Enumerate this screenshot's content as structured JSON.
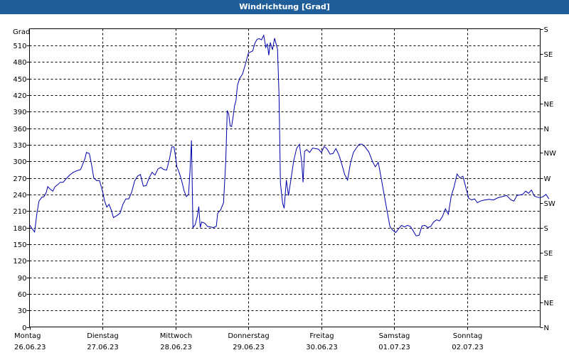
{
  "window": {
    "title": "Windrichtung [Grad]"
  },
  "chart_data": {
    "type": "line",
    "title": "Windrichtung [Grad]",
    "ylabel": "Grad",
    "ylim": [
      0,
      540
    ],
    "yticks": [
      0,
      30,
      60,
      90,
      120,
      150,
      180,
      210,
      240,
      270,
      300,
      330,
      360,
      390,
      420,
      450,
      480,
      510
    ],
    "right_axis_labels": [
      {
        "value": 0,
        "label": "N"
      },
      {
        "value": 45,
        "label": "NE"
      },
      {
        "value": 90,
        "label": "E"
      },
      {
        "value": 135,
        "label": "SE"
      },
      {
        "value": 180,
        "label": "S"
      },
      {
        "value": 225,
        "label": "SW"
      },
      {
        "value": 270,
        "label": "W"
      },
      {
        "value": 315,
        "label": "NW"
      },
      {
        "value": 360,
        "label": "N"
      },
      {
        "value": 405,
        "label": "NE"
      },
      {
        "value": 450,
        "label": "E"
      },
      {
        "value": 495,
        "label": "SE"
      },
      {
        "value": 540,
        "label": "S"
      }
    ],
    "x_range": [
      0,
      7
    ],
    "days": [
      {
        "day": "Montag",
        "date": "26.06.23"
      },
      {
        "day": "Dienstag",
        "date": "27.06.23"
      },
      {
        "day": "Mittwoch",
        "date": "28.06.23"
      },
      {
        "day": "Donnerstag",
        "date": "29.06.23"
      },
      {
        "day": "Freitag",
        "date": "30.06.23"
      },
      {
        "day": "Samstag",
        "date": "01.07.23"
      },
      {
        "day": "Sonntag",
        "date": "02.07.23"
      }
    ],
    "grid": true,
    "series": [
      {
        "color": "#0000aa",
        "points": [
          [
            0.0,
            185
          ],
          [
            0.04,
            177
          ],
          [
            0.07,
            172
          ],
          [
            0.1,
            205
          ],
          [
            0.13,
            228
          ],
          [
            0.17,
            235
          ],
          [
            0.2,
            236
          ],
          [
            0.23,
            244
          ],
          [
            0.25,
            254
          ],
          [
            0.28,
            250
          ],
          [
            0.32,
            246
          ],
          [
            0.35,
            254
          ],
          [
            0.39,
            258
          ],
          [
            0.42,
            262
          ],
          [
            0.46,
            262
          ],
          [
            0.5,
            268
          ],
          [
            0.55,
            275
          ],
          [
            0.6,
            280
          ],
          [
            0.65,
            283
          ],
          [
            0.7,
            285
          ],
          [
            0.73,
            295
          ],
          [
            0.76,
            305
          ],
          [
            0.78,
            316
          ],
          [
            0.8,
            315
          ],
          [
            0.82,
            314
          ],
          [
            0.85,
            294
          ],
          [
            0.88,
            270
          ],
          [
            0.92,
            265
          ],
          [
            0.96,
            265
          ],
          [
            1.0,
            246
          ],
          [
            1.03,
            228
          ],
          [
            1.06,
            217
          ],
          [
            1.09,
            222
          ],
          [
            1.12,
            212
          ],
          [
            1.15,
            198
          ],
          [
            1.2,
            202
          ],
          [
            1.24,
            206
          ],
          [
            1.28,
            222
          ],
          [
            1.32,
            232
          ],
          [
            1.36,
            232
          ],
          [
            1.4,
            244
          ],
          [
            1.44,
            264
          ],
          [
            1.48,
            273
          ],
          [
            1.52,
            276
          ],
          [
            1.56,
            255
          ],
          [
            1.6,
            256
          ],
          [
            1.64,
            270
          ],
          [
            1.68,
            280
          ],
          [
            1.72,
            275
          ],
          [
            1.76,
            286
          ],
          [
            1.8,
            289
          ],
          [
            1.84,
            285
          ],
          [
            1.88,
            284
          ],
          [
            1.92,
            305
          ],
          [
            1.95,
            326
          ],
          [
            1.98,
            326
          ],
          [
            2.0,
            310
          ],
          [
            2.02,
            290
          ],
          [
            2.05,
            280
          ],
          [
            2.08,
            268
          ],
          [
            2.12,
            246
          ],
          [
            2.15,
            236
          ],
          [
            2.18,
            240
          ],
          [
            2.2,
            284
          ],
          [
            2.22,
            338
          ],
          [
            2.24,
            180
          ],
          [
            2.27,
            185
          ],
          [
            2.3,
            200
          ],
          [
            2.32,
            218
          ],
          [
            2.34,
            180
          ],
          [
            2.36,
            190
          ],
          [
            2.4,
            188
          ],
          [
            2.44,
            182
          ],
          [
            2.48,
            181
          ],
          [
            2.52,
            180
          ],
          [
            2.56,
            182
          ],
          [
            2.58,
            206
          ],
          [
            2.62,
            212
          ],
          [
            2.66,
            225
          ],
          [
            2.69,
            300
          ],
          [
            2.71,
            392
          ],
          [
            2.73,
            386
          ],
          [
            2.75,
            364
          ],
          [
            2.77,
            363
          ],
          [
            2.79,
            380
          ],
          [
            2.81,
            400
          ],
          [
            2.83,
            410
          ],
          [
            2.85,
            437
          ],
          [
            2.88,
            450
          ],
          [
            2.92,
            458
          ],
          [
            2.96,
            476
          ],
          [
            3.0,
            496
          ],
          [
            3.03,
            498
          ],
          [
            3.06,
            500
          ],
          [
            3.09,
            514
          ],
          [
            3.12,
            521
          ],
          [
            3.15,
            522
          ],
          [
            3.18,
            520
          ],
          [
            3.21,
            528
          ],
          [
            3.24,
            506
          ],
          [
            3.26,
            513
          ],
          [
            3.28,
            492
          ],
          [
            3.3,
            515
          ],
          [
            3.33,
            502
          ],
          [
            3.36,
            523
          ],
          [
            3.4,
            503
          ],
          [
            3.42,
            420
          ],
          [
            3.44,
            260
          ],
          [
            3.47,
            224
          ],
          [
            3.49,
            215
          ],
          [
            3.52,
            266
          ],
          [
            3.55,
            238
          ],
          [
            3.58,
            264
          ],
          [
            3.62,
            300
          ],
          [
            3.66,
            323
          ],
          [
            3.7,
            331
          ],
          [
            3.73,
            300
          ],
          [
            3.75,
            262
          ],
          [
            3.77,
            318
          ],
          [
            3.8,
            321
          ],
          [
            3.84,
            316
          ],
          [
            3.88,
            324
          ],
          [
            3.92,
            323
          ],
          [
            3.96,
            322
          ],
          [
            4.0,
            316
          ],
          [
            4.04,
            327
          ],
          [
            4.08,
            322
          ],
          [
            4.12,
            313
          ],
          [
            4.16,
            314
          ],
          [
            4.2,
            323
          ],
          [
            4.24,
            312
          ],
          [
            4.28,
            295
          ],
          [
            4.32,
            276
          ],
          [
            4.36,
            266
          ],
          [
            4.4,
            297
          ],
          [
            4.44,
            316
          ],
          [
            4.48,
            324
          ],
          [
            4.52,
            331
          ],
          [
            4.56,
            331
          ],
          [
            4.6,
            326
          ],
          [
            4.65,
            317
          ],
          [
            4.7,
            300
          ],
          [
            4.74,
            290
          ],
          [
            4.78,
            298
          ],
          [
            4.82,
            270
          ],
          [
            4.86,
            240
          ],
          [
            4.9,
            211
          ],
          [
            4.94,
            182
          ],
          [
            4.98,
            175
          ],
          [
            5.02,
            171
          ],
          [
            5.06,
            178
          ],
          [
            5.1,
            184
          ],
          [
            5.14,
            181
          ],
          [
            5.18,
            184
          ],
          [
            5.22,
            182
          ],
          [
            5.26,
            174
          ],
          [
            5.3,
            165
          ],
          [
            5.34,
            166
          ],
          [
            5.38,
            183
          ],
          [
            5.42,
            184
          ],
          [
            5.46,
            180
          ],
          [
            5.5,
            182
          ],
          [
            5.54,
            190
          ],
          [
            5.58,
            194
          ],
          [
            5.62,
            192
          ],
          [
            5.66,
            200
          ],
          [
            5.7,
            214
          ],
          [
            5.74,
            204
          ],
          [
            5.78,
            237
          ],
          [
            5.82,
            254
          ],
          [
            5.86,
            277
          ],
          [
            5.9,
            270
          ],
          [
            5.94,
            273
          ],
          [
            5.98,
            253
          ],
          [
            6.02,
            233
          ],
          [
            6.06,
            230
          ],
          [
            6.1,
            232
          ],
          [
            6.14,
            225
          ],
          [
            6.18,
            228
          ],
          [
            6.24,
            230
          ],
          [
            6.3,
            231
          ],
          [
            6.36,
            230
          ],
          [
            6.42,
            234
          ],
          [
            6.48,
            236
          ],
          [
            6.54,
            238
          ],
          [
            6.6,
            230
          ],
          [
            6.64,
            228
          ],
          [
            6.68,
            238
          ],
          [
            6.72,
            239
          ],
          [
            6.76,
            240
          ],
          [
            6.8,
            246
          ],
          [
            6.84,
            242
          ],
          [
            6.88,
            248
          ],
          [
            6.92,
            237
          ],
          [
            6.96,
            235
          ],
          [
            7.0,
            234
          ],
          [
            7.04,
            236
          ],
          [
            7.08,
            240
          ],
          [
            7.12,
            232
          ]
        ]
      }
    ]
  }
}
